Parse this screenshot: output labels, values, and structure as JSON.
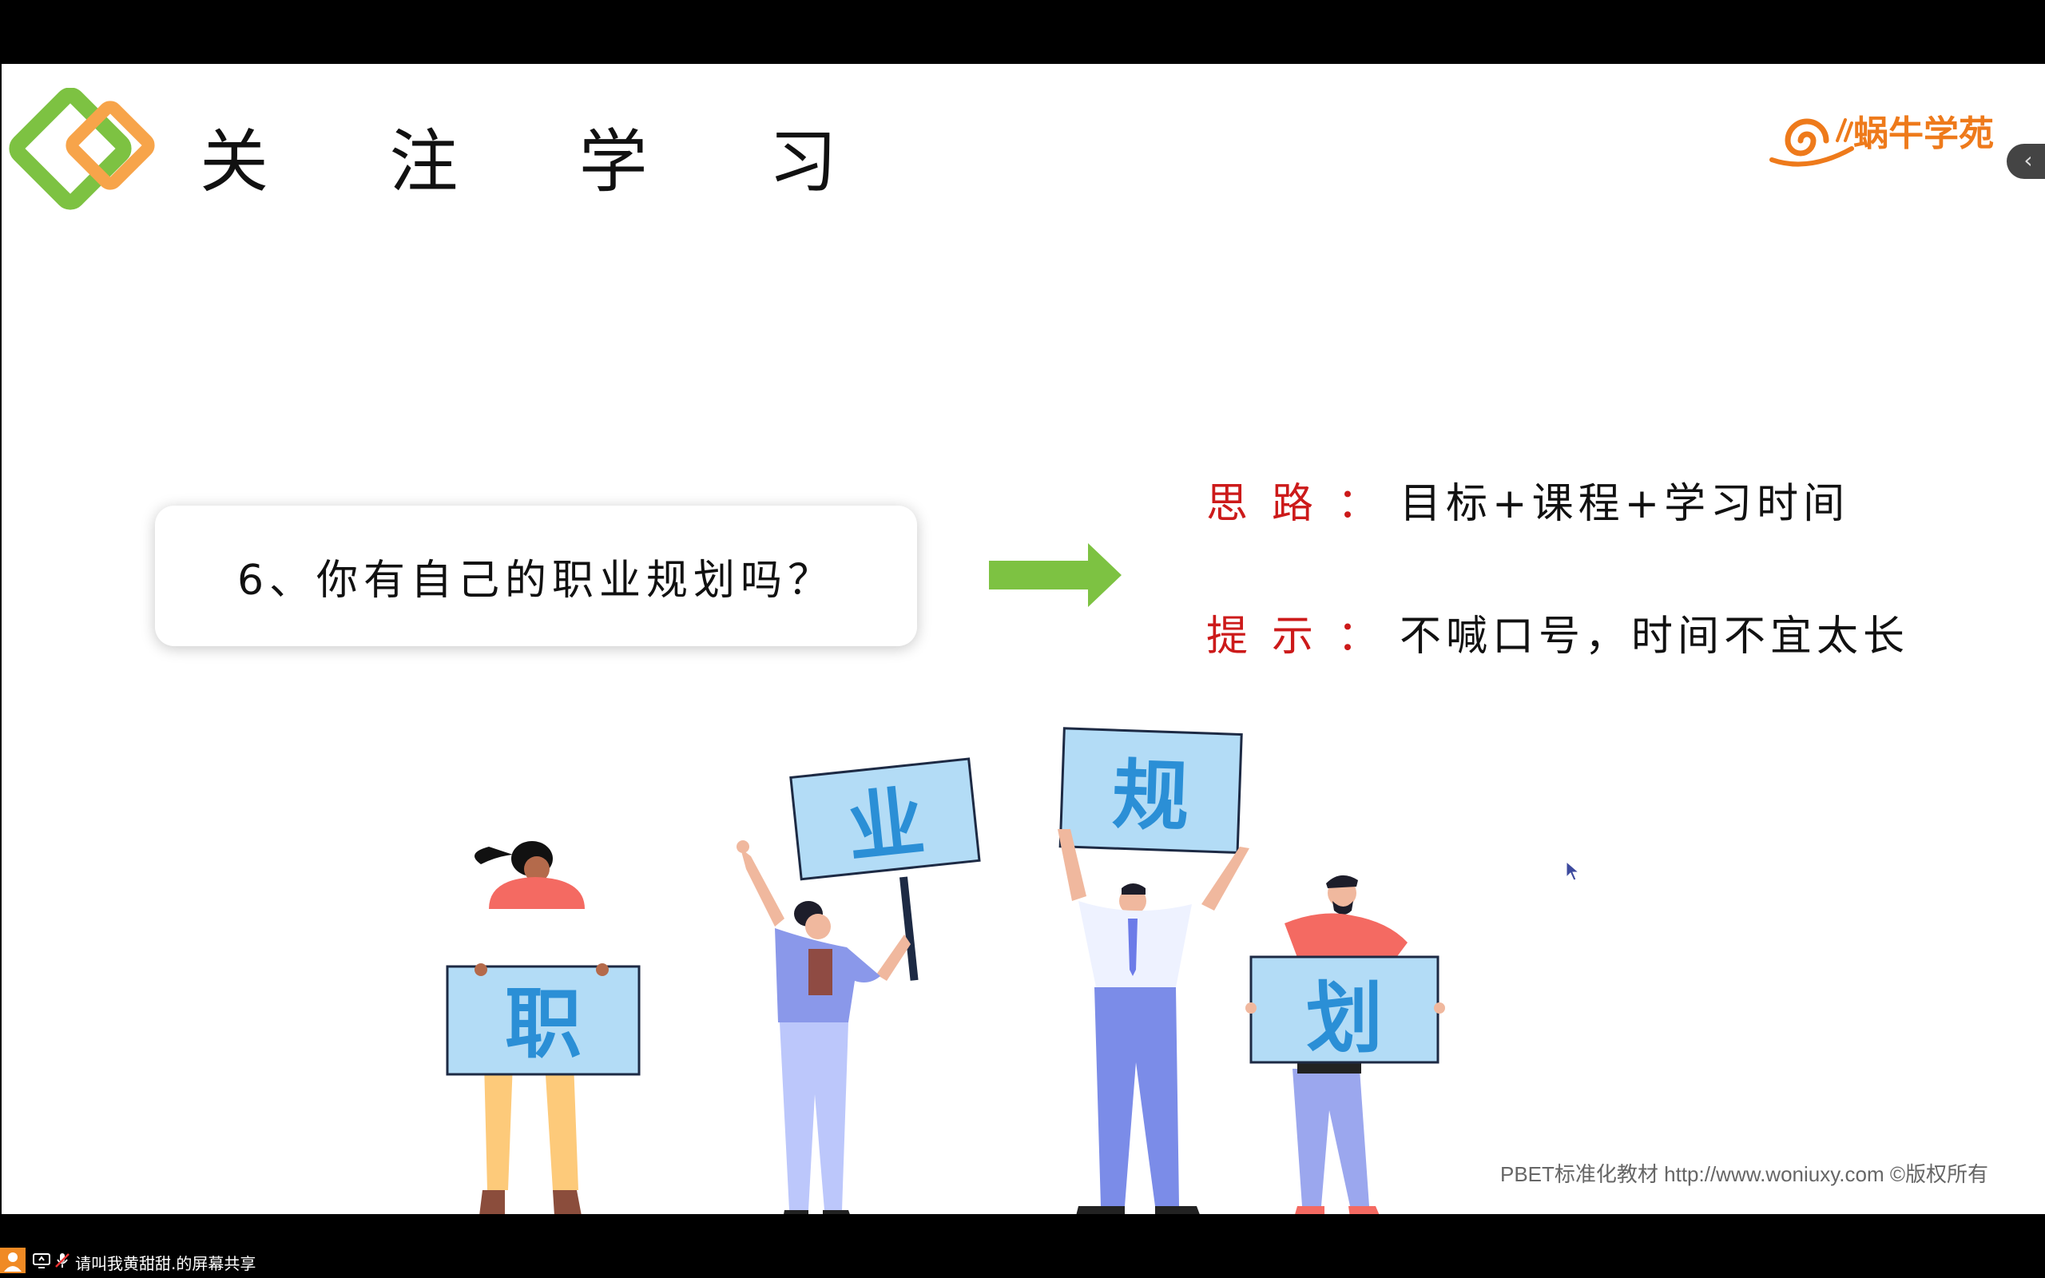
{
  "slide": {
    "title": "关 注 学 习",
    "brand": "蜗牛学苑",
    "question": "6、你有自己的职业规划吗？",
    "hints": [
      {
        "label": "思路",
        "colon": "：",
        "text": "目标+课程+学习时间"
      },
      {
        "label": "提示",
        "colon": "：",
        "text": "不喊口号，时间不宜太长"
      }
    ],
    "signs": [
      "职",
      "业",
      "规",
      "划"
    ],
    "footer": "PBET标准化教材  http://www.woniuxy.com ©版权所有",
    "side_tab_glyph": "‹"
  },
  "taskbar": {
    "share_text": "请叫我黄甜甜.的屏幕共享"
  },
  "colors": {
    "accent_green": "#7dc242",
    "accent_orange": "#f7a44a",
    "hint_label_red": "#cc1a1a",
    "sign_blue": "#b3dcf6",
    "sign_text_blue": "#2b8fd6",
    "brand_orange": "#ee7a1b"
  }
}
